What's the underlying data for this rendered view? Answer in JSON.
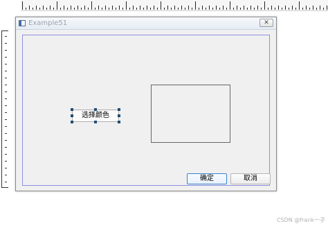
{
  "window": {
    "title": "Example51",
    "close_glyph": "✕"
  },
  "buttons": {
    "select_color": "选择颜色",
    "ok": "确定",
    "cancel": "取消"
  },
  "watermark": "CSDN @frank一子"
}
